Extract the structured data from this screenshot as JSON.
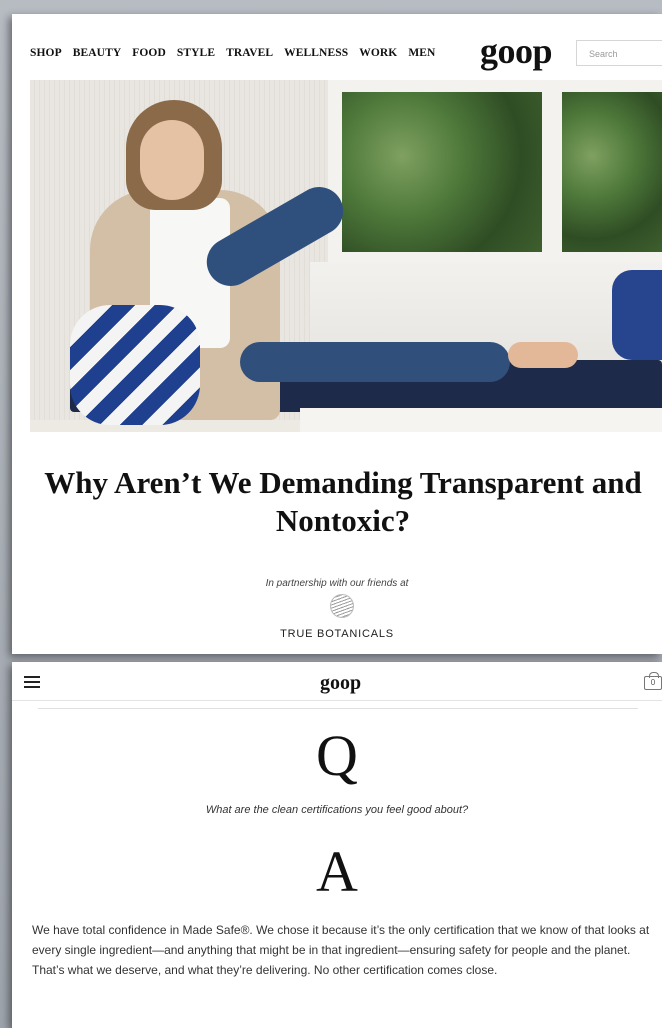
{
  "desktop": {
    "nav_items": [
      "SHOP",
      "BEAUTY",
      "FOOD",
      "STYLE",
      "TRAVEL",
      "WELLNESS",
      "WORK",
      "MEN"
    ],
    "logo": "goop",
    "search_placeholder": "Search"
  },
  "article": {
    "title": "Why Aren’t We Demanding Transparent and Nontoxic?",
    "partner_line": "In partnership with our friends at",
    "partner_name": "TRUE BOTANICALS"
  },
  "mobile": {
    "logo": "goop",
    "cart_count": "0",
    "q_letter": "Q",
    "question": "What are the clean certifications you feel good about?",
    "a_letter": "A",
    "answer": "We have total confidence in Made Safe®. We chose it because it’s the only certification that we know of that looks at every single ingredient—and anything that might be in that ingredient—ensuring safety for people and the planet. That’s what we deserve, and what they’re delivering. No other certification comes close."
  },
  "icons": {
    "menu": "hamburger-icon",
    "cart": "shopping-bag-icon",
    "partner": "fingerprint-logo-icon"
  }
}
